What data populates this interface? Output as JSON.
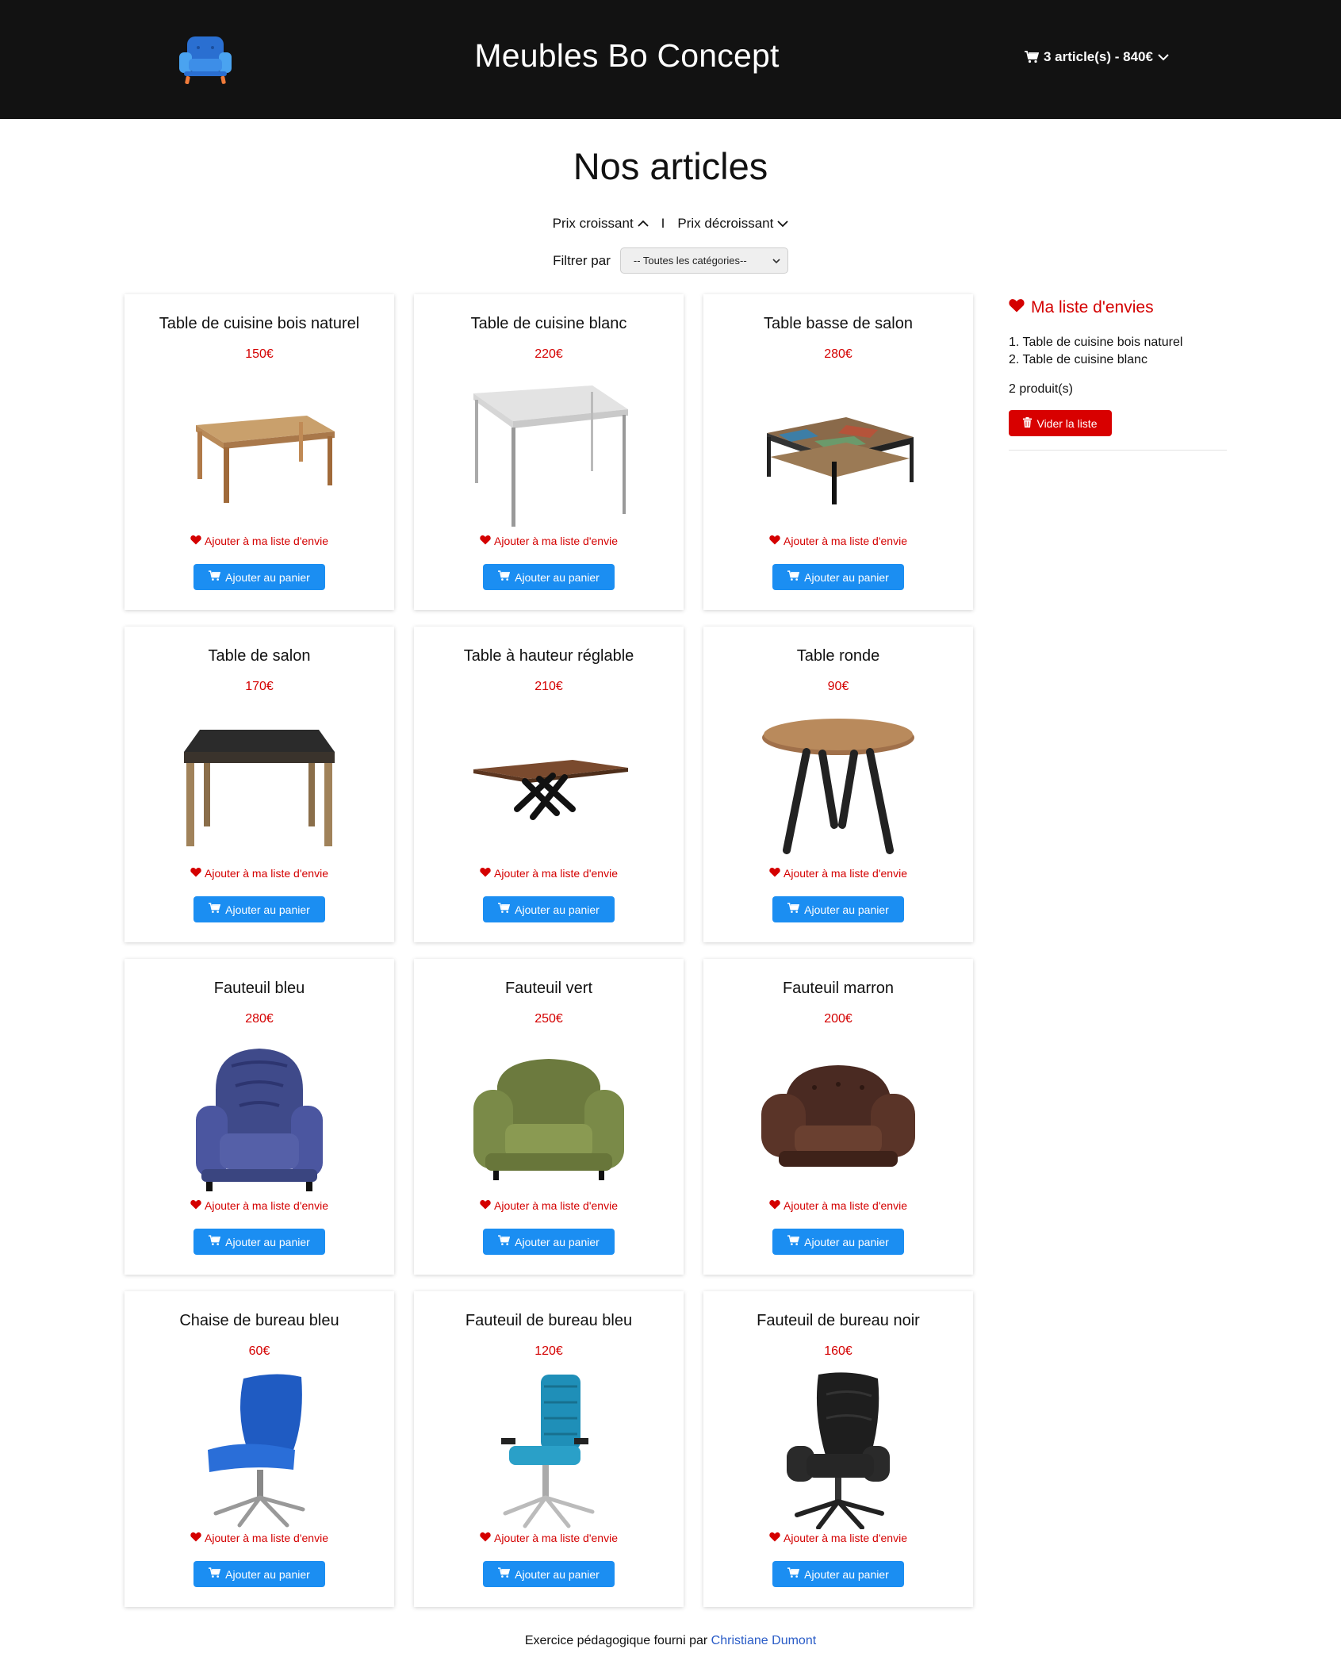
{
  "header": {
    "title": "Meubles Bo Concept",
    "cart_label": "3 article(s) - 840€",
    "logo_icon": "armchair-logo-icon",
    "cart_icon": "cart-icon"
  },
  "page_title": "Nos articles",
  "sort": {
    "asc_label": "Prix croissant",
    "separator": "I",
    "desc_label": "Prix décroissant"
  },
  "filter": {
    "label": "Filtrer par",
    "selected": "-- Toutes les catégories--"
  },
  "products": [
    {
      "name": "Table de cuisine bois naturel",
      "price": "150€",
      "image": "table-wood-natural",
      "wish_label": "Ajouter à ma liste d'envie",
      "cart_label": "Ajouter au panier"
    },
    {
      "name": "Table de cuisine blanc",
      "price": "220€",
      "image": "table-white",
      "wish_label": "Ajouter à ma liste d'envie",
      "cart_label": "Ajouter au panier"
    },
    {
      "name": "Table basse de salon",
      "price": "280€",
      "image": "coffee-table",
      "wish_label": "Ajouter à ma liste d'envie",
      "cart_label": "Ajouter au panier"
    },
    {
      "name": "Table de salon",
      "price": "170€",
      "image": "dark-top-table",
      "wish_label": "Ajouter à ma liste d'envie",
      "cart_label": "Ajouter au panier"
    },
    {
      "name": "Table à hauteur réglable",
      "price": "210€",
      "image": "x-base-table",
      "wish_label": "Ajouter à ma liste d'envie",
      "cart_label": "Ajouter au panier"
    },
    {
      "name": "Table ronde",
      "price": "90€",
      "image": "round-table",
      "wish_label": "Ajouter à ma liste d'envie",
      "cart_label": "Ajouter au panier"
    },
    {
      "name": "Fauteuil bleu",
      "price": "280€",
      "image": "armchair-blue",
      "wish_label": "Ajouter à ma liste d'envie",
      "cart_label": "Ajouter au panier"
    },
    {
      "name": "Fauteuil vert",
      "price": "250€",
      "image": "armchair-green",
      "wish_label": "Ajouter à ma liste d'envie",
      "cart_label": "Ajouter au panier"
    },
    {
      "name": "Fauteuil marron",
      "price": "200€",
      "image": "armchair-brown",
      "wish_label": "Ajouter à ma liste d'envie",
      "cart_label": "Ajouter au panier"
    },
    {
      "name": "Chaise de bureau bleu",
      "price": "60€",
      "image": "office-chair-blue",
      "wish_label": "Ajouter à ma liste d'envie",
      "cart_label": "Ajouter au panier"
    },
    {
      "name": "Fauteuil de bureau bleu",
      "price": "120€",
      "image": "office-armchair-blue",
      "wish_label": "Ajouter à ma liste d'envie",
      "cart_label": "Ajouter au panier"
    },
    {
      "name": "Fauteuil de bureau noir",
      "price": "160€",
      "image": "office-armchair-black",
      "wish_label": "Ajouter à ma liste d'envie",
      "cart_label": "Ajouter au panier"
    }
  ],
  "wishlist": {
    "title": "Ma liste d'envies",
    "items": [
      "1. Table de cuisine bois naturel",
      "2. Table de cuisine blanc"
    ],
    "count_label": "2 produit(s)",
    "clear_label": "Vider la liste"
  },
  "footer": {
    "text": "Exercice pédagogique fourni par ",
    "author": "Christiane Dumont"
  },
  "colors": {
    "header_bg": "#121212",
    "accent_red": "#d40000",
    "button_blue": "#1b8ef2",
    "link_blue": "#2a5cc7"
  }
}
